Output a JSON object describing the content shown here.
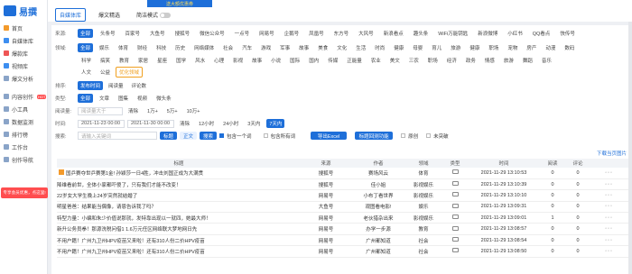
{
  "logo": {
    "text": "易撰"
  },
  "ad": {
    "text": "送大额优惠券"
  },
  "sidebar": {
    "items": [
      {
        "label": "首页",
        "icon": "home-icon"
      },
      {
        "label": "自媒体库",
        "icon": "library-icon"
      },
      {
        "label": "爆款库",
        "icon": "hot-icon"
      },
      {
        "label": "视频库",
        "icon": "video-icon"
      },
      {
        "label": "爆文分析",
        "icon": "analysis-icon"
      },
      {
        "label": "内容创作",
        "icon": "edit-icon",
        "badge": "HOT"
      },
      {
        "label": "小工具",
        "icon": "tool-icon"
      },
      {
        "label": "数据监测",
        "icon": "monitor-icon"
      },
      {
        "label": "排行榜",
        "icon": "rank-icon"
      },
      {
        "label": "工作台",
        "icon": "desk-icon"
      },
      {
        "label": "创作导航",
        "icon": "nav-icon"
      }
    ],
    "promo": "专享会员优惠，点这里!"
  },
  "header": {
    "tabs": [
      "自媒体库",
      "爆文精选"
    ],
    "mode_label": "简洁模式"
  },
  "filters": {
    "source_label": "来源:",
    "sources": [
      "全部",
      "头条号",
      "百家号",
      "大鱼号",
      "搜狐号",
      "微信公众号",
      "一点号",
      "网易号",
      "企鹅号",
      "凤凰号",
      "东方号",
      "大风号",
      "新浪看点",
      "趣头条",
      "WiFi万能钥匙",
      "新浪微博",
      "小红书",
      "QQ看点",
      "快传号"
    ],
    "domain_label": "领域:",
    "domains_row1": [
      "全部",
      "娱乐",
      "体育",
      "财经",
      "科技",
      "历史",
      "网络媒体",
      "社会",
      "汽车",
      "游戏",
      "军事",
      "故事",
      "美食",
      "文化",
      "生活",
      "时尚",
      "健康",
      "母婴",
      "育儿",
      "旅游",
      "健康",
      "职场",
      "宠物",
      "房产",
      "动漫",
      "数码"
    ],
    "domains_row2": [
      "科学",
      "搞笑",
      "教育",
      "家居",
      "星座",
      "国学",
      "风水",
      "心理",
      "影视",
      "故事",
      "小说",
      "国际",
      "国内",
      "传媒",
      "正能量",
      "农业",
      "美文",
      "三农",
      "职场",
      "经济",
      "政务",
      "情感",
      "旅游",
      "舞蹈",
      "音乐"
    ],
    "domains_row3": [
      "人文",
      "公益"
    ],
    "domain_warn": "优化领域",
    "sort_label": "排序:",
    "sorts": [
      "发布时间",
      "阅读量",
      "评论数"
    ],
    "type_label": "类型:",
    "types": [
      "全部",
      "文章",
      "图集",
      "视频",
      "微头条"
    ],
    "reads_label": "阅读量:",
    "reads_placeholder": "阅读量大于",
    "reads_opts": [
      "清除",
      "1万+",
      "5万+",
      "10万+"
    ],
    "time_label": "时间:",
    "time_start": "2021-11-23 00:00",
    "time_end": "2021-11-30 00:00",
    "time_opts": [
      "清除",
      "12小时",
      "24小时",
      "3天内",
      "7天内"
    ],
    "search_label": "搜索:",
    "search_placeholder": "请输入关键词",
    "search_modes": [
      "标题",
      "正文"
    ],
    "search_button": "搜索",
    "check_one": "包含一个词",
    "check_exclude": "包含所有词",
    "export_button": "导出Excel",
    "batch_button": "标题回测功能",
    "check_orig": "原创",
    "check_vid": "未突破"
  },
  "results": {
    "download_link": "下载当页图片",
    "columns": [
      "标题",
      "来源",
      "作者",
      "领域",
      "类型",
      "时间",
      "阅读",
      "评论"
    ],
    "rows": [
      {
        "title": "国乒赛夺世乒赛第1金! 孙颖莎一日4胜，冲击刘国正成为大满贯",
        "source": "搜狐号",
        "author": "赛场风云",
        "domain": "体育",
        "type": "article",
        "time": "2021-11-29 13:10:53",
        "reads": "0",
        "comments": "0"
      },
      {
        "title": "降维看前世，全体小家都吓傻了，只有我们才能不改变！",
        "source": "搜狐号",
        "author": "佳小姐",
        "domain": "影视娱乐",
        "type": "video",
        "time": "2021-11-29 13:10:39",
        "reads": "0",
        "comments": "0"
      },
      {
        "title": "22岁女大学生晚上24岁突然就结婚了",
        "source": "网易号",
        "author": "小布丁看世界",
        "domain": "影视娱乐",
        "type": "video",
        "time": "2021-11-29 13:10:10",
        "reads": "0",
        "comments": "0"
      },
      {
        "title": "明星爸爸：结果能当偶像，请恩告诉我了吗？",
        "source": "大鱼号",
        "author": "观图看电影!",
        "domain": "娱乐",
        "type": "video",
        "time": "2021-11-29 13:09:31",
        "reads": "0",
        "comments": "0"
      },
      {
        "title": "特型力量：小编和朱少价值说那就，发特靠出现以一就四，她最大师！",
        "source": "网易号",
        "author": "老伙猎杂出来",
        "domain": "影视娱乐",
        "type": "video",
        "time": "2021-11-29 13:09:01",
        "reads": "1",
        "comments": "0"
      },
      {
        "title": "新升公务员拳！那源洗税问借1 1.6万元任区网络联大梦地网日先",
        "source": "网易号",
        "author": "办学一步源",
        "domain": "教育",
        "type": "article",
        "time": "2021-11-29 13:08:57",
        "reads": "0",
        "comments": "0"
      },
      {
        "title": "不用户籍！广州九卫州HPV疫苗又来啦！还有310人份二价HPV疫苗",
        "source": "网易号",
        "author": "广州都知道",
        "domain": "社会",
        "type": "article",
        "time": "2021-11-29 13:08:54",
        "reads": "0",
        "comments": "0"
      },
      {
        "title": "不用户籍！广州九卫州HPV疫苗又来啦！还有310人份二价HPV疫苗",
        "source": "网易号",
        "author": "广州都知道",
        "domain": "社会",
        "type": "article",
        "time": "2021-11-29 13:08:50",
        "reads": "0",
        "comments": "0"
      }
    ]
  }
}
